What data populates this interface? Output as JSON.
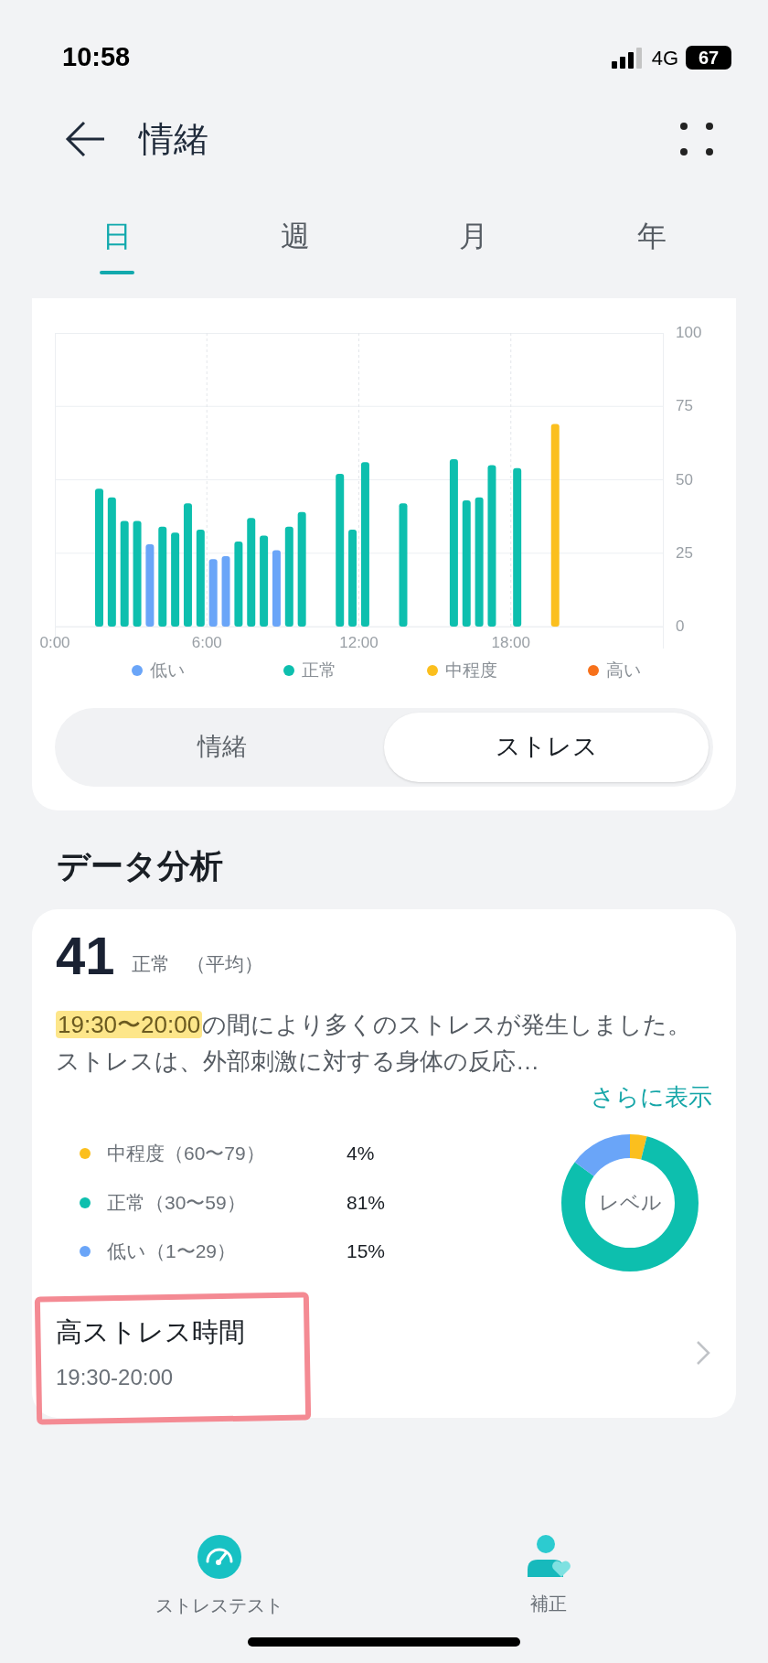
{
  "status_bar": {
    "time": "10:58",
    "network": "4G",
    "battery": "67"
  },
  "header": {
    "title": "情緒"
  },
  "tabs": [
    {
      "label": "日",
      "selected": true
    },
    {
      "label": "週",
      "selected": false
    },
    {
      "label": "月",
      "selected": false
    },
    {
      "label": "年",
      "selected": false
    }
  ],
  "chart": {
    "chart_data": {
      "type": "bar",
      "x": [
        1.75,
        2.25,
        2.75,
        3.25,
        3.75,
        4.25,
        4.75,
        5.25,
        5.75,
        6.25,
        6.75,
        7.25,
        7.75,
        8.25,
        8.75,
        9.25,
        9.75,
        11.25,
        11.75,
        12.25,
        13.75,
        15.75,
        16.25,
        16.75,
        17.25,
        18.25,
        19.75
      ],
      "series": [
        {
          "name": "低い",
          "color": "#6aa5f8",
          "values": [
            null,
            null,
            null,
            null,
            28,
            null,
            null,
            null,
            null,
            23,
            24,
            null,
            null,
            null,
            26,
            null,
            null,
            null,
            null,
            null,
            null,
            null,
            null,
            null,
            null,
            null,
            null
          ]
        },
        {
          "name": "正常",
          "color": "#0dbfae",
          "values": [
            47,
            44,
            36,
            36,
            null,
            34,
            32,
            42,
            33,
            null,
            null,
            29,
            37,
            31,
            null,
            34,
            39,
            52,
            33,
            56,
            42,
            57,
            43,
            44,
            55,
            54,
            null
          ]
        },
        {
          "name": "中程度",
          "color": "#fbbf1e",
          "values": [
            null,
            null,
            null,
            null,
            null,
            null,
            null,
            null,
            null,
            null,
            null,
            null,
            null,
            null,
            null,
            null,
            null,
            null,
            null,
            null,
            null,
            null,
            null,
            null,
            null,
            null,
            69
          ]
        },
        {
          "name": "高い",
          "color": "#f7711b",
          "values": [
            null,
            null,
            null,
            null,
            null,
            null,
            null,
            null,
            null,
            null,
            null,
            null,
            null,
            null,
            null,
            null,
            null,
            null,
            null,
            null,
            null,
            null,
            null,
            null,
            null,
            null,
            null
          ]
        }
      ],
      "xlim": [
        0,
        24
      ],
      "xticks": [
        {
          "value": 0,
          "label": "0:00"
        },
        {
          "value": 6,
          "label": "6:00"
        },
        {
          "value": 12,
          "label": "12:00"
        },
        {
          "value": 18,
          "label": "18:00"
        }
      ],
      "ylim": [
        0,
        100
      ],
      "yticks": [
        0,
        25,
        50,
        75,
        100
      ],
      "grid": true
    }
  },
  "mode_toggle": [
    {
      "label": "情緒",
      "selected": false
    },
    {
      "label": "ストレス",
      "selected": true
    }
  ],
  "analysis": {
    "heading": "データ分析",
    "score": "41",
    "score_label": "正常",
    "score_note": "（平均）",
    "summary": {
      "highlighted": "19:30〜20:00",
      "text": "の間により多くのストレスが発生しました。ストレスは、外部刺激に対する身体の反応…"
    },
    "more_link": "さらに表示",
    "levels": [
      {
        "label": "中程度（60〜79）",
        "share": "4%",
        "color": "#fbbf1e"
      },
      {
        "label": "正常（30〜59）",
        "share": "81%",
        "color": "#0dbfae"
      },
      {
        "label": "低い（1〜29）",
        "share": "15%",
        "color": "#6aa5f8"
      }
    ],
    "donut_label": "レベル",
    "high_stress": {
      "title": "高ストレス時間",
      "time": "19:30-20:00"
    }
  },
  "bottom_nav": [
    {
      "label": "ストレステスト",
      "kind": "gauge"
    },
    {
      "label": "補正",
      "kind": "person"
    }
  ]
}
